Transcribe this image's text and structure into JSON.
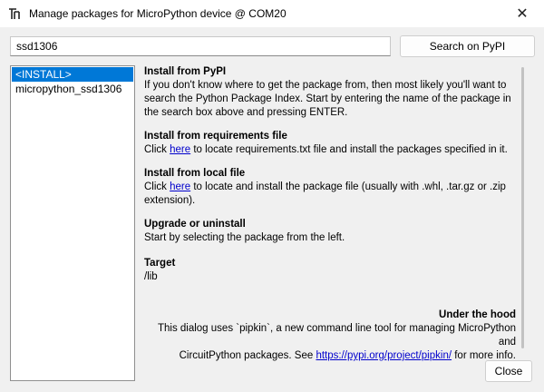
{
  "window": {
    "title": "Manage packages for MicroPython device @ COM20",
    "close_glyph": "✕"
  },
  "search": {
    "value": "ssd1306",
    "button_label": "Search on PyPI"
  },
  "packages": [
    "<INSTALL>",
    "micropython_ssd1306"
  ],
  "info": {
    "pypi": {
      "heading": "Install from PyPI",
      "body": "If you don't know where to get the package from, then most likely you'll want to search the Python Package Index. Start by entering the name of the package in the search box above and pressing ENTER."
    },
    "requirements": {
      "heading": "Install from requirements file",
      "pre": "Click ",
      "link": "here",
      "post": " to locate requirements.txt file and install the packages specified in it."
    },
    "local": {
      "heading": "Install from local file",
      "pre": "Click ",
      "link": "here",
      "post": " to locate and install the package file (usually with .whl, .tar.gz or .zip extension)."
    },
    "upgrade": {
      "heading": "Upgrade or uninstall",
      "body": "Start by selecting the package from the left."
    },
    "target": {
      "heading": "Target",
      "body": "/lib"
    },
    "hood": {
      "heading": "Under the hood",
      "line1": "This dialog uses `pipkin`, a new command line tool for managing MicroPython and",
      "line2_pre": "CircuitPython packages. See ",
      "line2_link": "https://pypi.org/project/pipkin/",
      "line2_post": " for more info."
    }
  },
  "footer": {
    "close_label": "Close"
  },
  "colors": {
    "selection": "#0078d7",
    "link": "#0000cc"
  },
  "icons": {
    "app": "thonny-icon",
    "close": "close-icon"
  }
}
